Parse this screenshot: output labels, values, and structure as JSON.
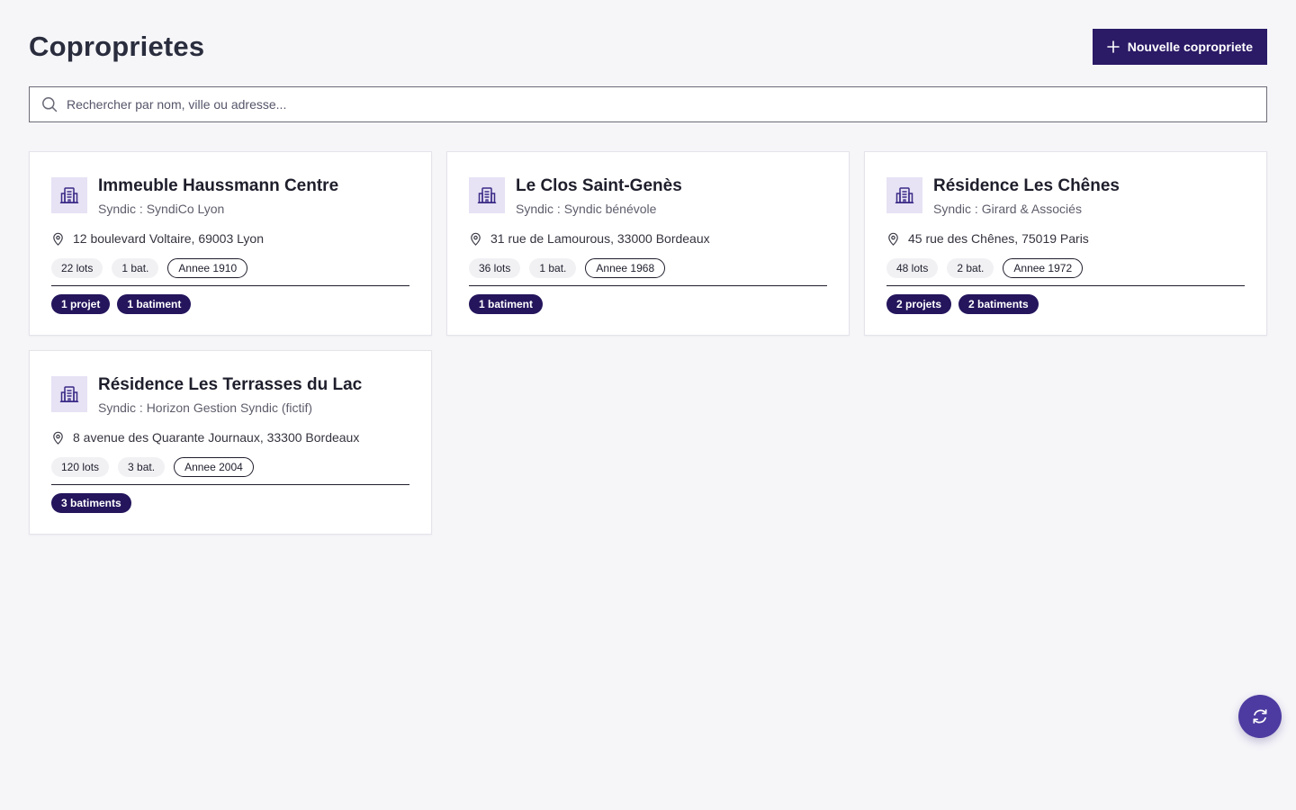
{
  "header": {
    "title": "Coproprietes",
    "new_button_label": "Nouvelle copropriete"
  },
  "search": {
    "placeholder": "Rechercher par nom, ville ou adresse...",
    "value": ""
  },
  "icons": {
    "new_button": "plus-icon",
    "search": "search-icon",
    "card": "building-icon",
    "address": "map-pin-icon",
    "fab": "refresh-icon"
  },
  "colors": {
    "primary": "#2b1a66",
    "badge": "#24155c",
    "fab": "#4d3ba1",
    "icon_bg": "#e7e2f4"
  },
  "cards": [
    {
      "name": "Immeuble Haussmann Centre",
      "syndic": "Syndic : SyndiCo Lyon",
      "address": "12 boulevard Voltaire, 69003 Lyon",
      "lots": "22 lots",
      "bat": "1 bat.",
      "annee": "Annee 1910",
      "badges": [
        "1 projet",
        "1 batiment"
      ]
    },
    {
      "name": "Le Clos Saint-Genès",
      "syndic": "Syndic : Syndic bénévole",
      "address": "31 rue de Lamourous, 33000 Bordeaux",
      "lots": "36 lots",
      "bat": "1 bat.",
      "annee": "Annee 1968",
      "badges": [
        "1 batiment"
      ]
    },
    {
      "name": "Résidence Les Chênes",
      "syndic": "Syndic : Girard & Associés",
      "address": "45 rue des Chênes, 75019 Paris",
      "lots": "48 lots",
      "bat": "2 bat.",
      "annee": "Annee 1972",
      "badges": [
        "2 projets",
        "2 batiments"
      ]
    },
    {
      "name": "Résidence Les Terrasses du Lac",
      "syndic": "Syndic : Horizon Gestion Syndic (fictif)",
      "address": "8 avenue des Quarante Journaux, 33300 Bordeaux",
      "lots": "120 lots",
      "bat": "3 bat.",
      "annee": "Annee 2004",
      "badges": [
        "3 batiments"
      ]
    }
  ]
}
